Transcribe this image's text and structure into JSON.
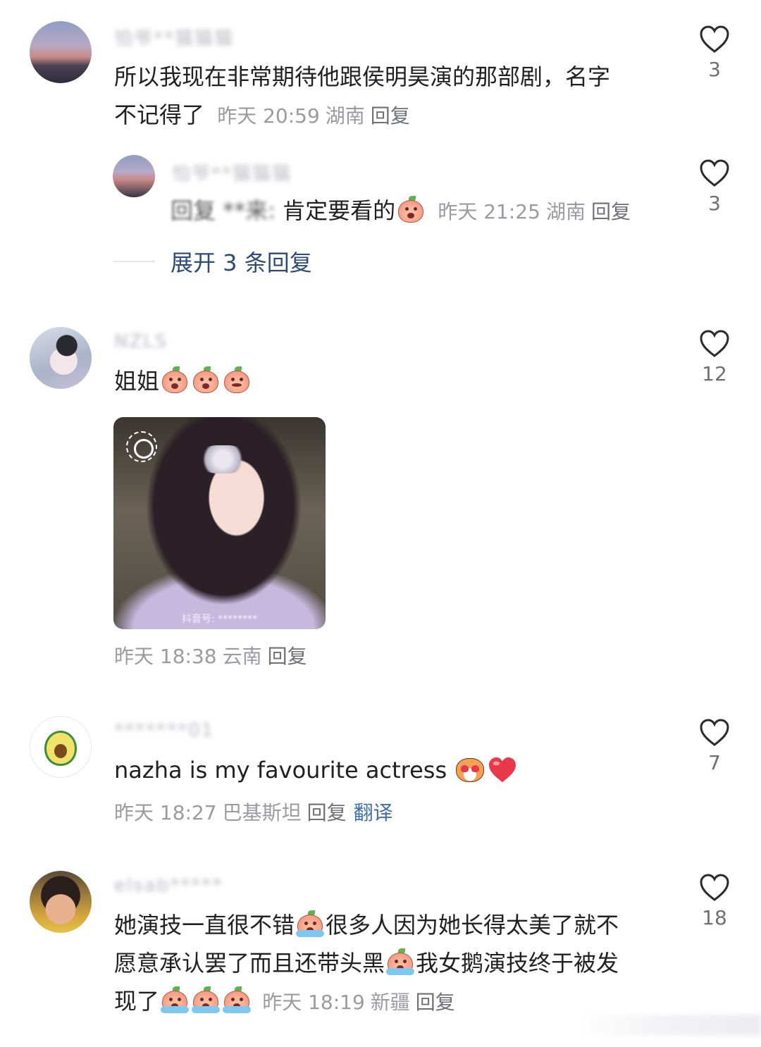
{
  "comments": [
    {
      "username": "怕爷**猫猫猫",
      "text_line1": "所以我现在非常期待他跟侯明昊演的那部剧，名字",
      "text_line2": "不记得了",
      "time": "昨天 20:59",
      "location": "湖南",
      "reply_label": "回复",
      "likes": "3",
      "replies": [
        {
          "username": "怕爷**猫猫猫",
          "prefix": "回复",
          "mention": "**来:",
          "text": "肯定要看的",
          "time": "昨天 21:25",
          "location": "湖南",
          "reply_label": "回复",
          "likes": "3"
        }
      ],
      "expand_label": "展开 3 条回复"
    },
    {
      "username": "NZLS",
      "text": "姐姐",
      "time": "昨天 18:38",
      "location": "云南",
      "reply_label": "回复",
      "likes": "12",
      "image_watermark": "抖音号: ********"
    },
    {
      "username": "*******01",
      "text": "nazha is my favourite actress",
      "time": "昨天 18:27",
      "location": "巴基斯坦",
      "reply_label": "回复",
      "translate_label": "翻译",
      "likes": "7"
    },
    {
      "username": "elsab*****",
      "text_line1": "她演技一直很不错",
      "text_line1b": "很多人因为她长得太美了就不",
      "text_line2": "愿意承认罢了而且还带头黑",
      "text_line2b": "我女鹅演技终于被发",
      "text_line3": "现了",
      "time": "昨天 18:19",
      "location": "新疆",
      "reply_label": "回复",
      "likes": "18"
    }
  ],
  "icons": {
    "like": "heart-outline-icon",
    "peach": "peach-emoji",
    "dog": "dog-heart-eyes-emoji",
    "red_heart": "red-heart-emoji",
    "avocado": "avocado-avatar"
  },
  "colors": {
    "link": "#2e4a7a",
    "translate": "#3e6fa8",
    "meta": "#9a9aa2"
  }
}
